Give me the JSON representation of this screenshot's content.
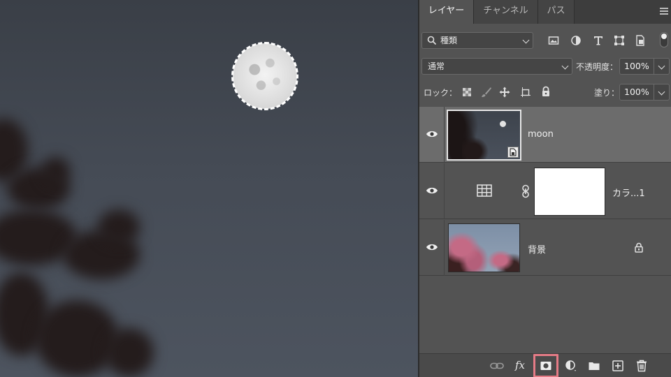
{
  "panel": {
    "tabs": [
      {
        "label": "レイヤー",
        "active": true
      },
      {
        "label": "チャンネル",
        "active": false
      },
      {
        "label": "パス",
        "active": false
      }
    ],
    "filter": {
      "kind_label": "種類"
    },
    "blend": {
      "mode": "通常",
      "opacity_label": "不透明度：",
      "opacity_value": "100%"
    },
    "lock": {
      "label": "ロック：",
      "fill_label": "塗り：",
      "fill_value": "100%"
    },
    "layers": [
      {
        "name": "moon",
        "selected": true,
        "type": "smart-object"
      },
      {
        "name": "カラ...1",
        "selected": false,
        "type": "fill-layer"
      },
      {
        "name": "背景",
        "selected": false,
        "type": "background",
        "locked": true
      }
    ]
  },
  "colors": {
    "highlight": "#e57b86",
    "panel_bg": "#535353",
    "selected_layer": "#6c6c6c"
  },
  "icons": {
    "search": "search-icon",
    "eye": "eye-icon",
    "lock": "lock-icon",
    "link": "link-icon",
    "fx": "fx-icon",
    "mask": "layer-mask-icon",
    "adjustment": "adjustment-icon",
    "folder": "folder-icon",
    "new_layer": "new-layer-icon",
    "trash": "trash-icon"
  },
  "bottom": {
    "fx_label": "fx"
  }
}
